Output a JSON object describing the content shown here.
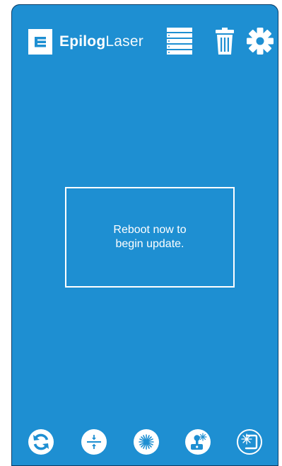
{
  "brand": {
    "bold": "Epilog",
    "light": "Laser"
  },
  "header": {
    "icons": [
      "queue-list-icon",
      "trash-icon",
      "gear-icon"
    ]
  },
  "message": {
    "line1": "Reboot now to",
    "line2": "begin update."
  },
  "footer": {
    "buttons": [
      "refresh-icon",
      "focus-icon",
      "laser-pointer-icon",
      "joystick-laser-icon",
      "corner-laser-icon"
    ]
  },
  "colors": {
    "background": "#1e8fd2",
    "foreground": "#ffffff"
  }
}
